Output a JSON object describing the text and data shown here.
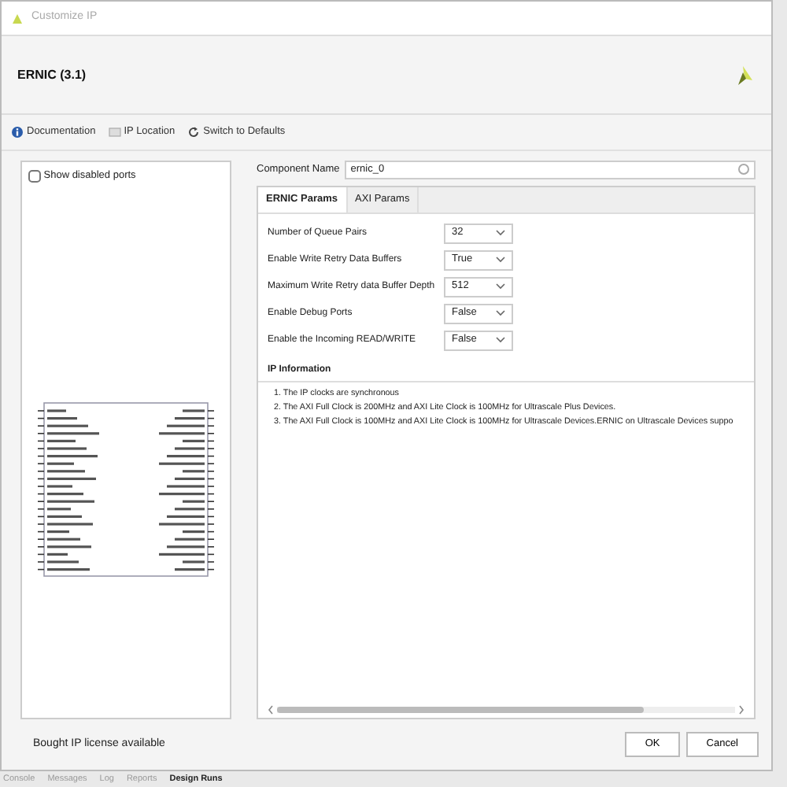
{
  "window": {
    "title": "Customize IP"
  },
  "header": {
    "title": "ERNIC (3.1)"
  },
  "toolbar": [
    {
      "kind": "info",
      "label": "Documentation"
    },
    {
      "kind": "folder",
      "label": "IP Location"
    },
    {
      "kind": "refresh",
      "label": "Switch to Defaults"
    }
  ],
  "left_panel": {
    "show_disabled_ports": {
      "label": "Show disabled ports",
      "checked": false
    }
  },
  "component_name": {
    "label": "Component Name",
    "value": "ernic_0"
  },
  "tabs": [
    {
      "label": "ERNIC Params",
      "selected": true
    },
    {
      "label": "AXI Params",
      "selected": false
    }
  ],
  "params": [
    {
      "label": "Number of Queue Pairs",
      "value": "32"
    },
    {
      "label": "Enable Write Retry Data Buffers",
      "value": "True"
    },
    {
      "label": "Maximum Write Retry data Buffer Depth",
      "value": "512"
    },
    {
      "label": "Enable Debug Ports",
      "value": "False"
    },
    {
      "label": "Enable the Incoming READ/WRITE",
      "value": "False"
    }
  ],
  "ip_information": {
    "title": "IP Information",
    "items": [
      "1. The IP clocks are synchronous",
      "2. The AXI Full Clock is 200MHz and AXI Lite Clock is 100MHz for Ultrascale Plus Devices.",
      "3. The AXI Full Clock is 100MHz and AXI Lite Clock is 100MHz for Ultrascale Devices.ERNIC on Ultrascale Devices suppo"
    ]
  },
  "footer": {
    "note": "Bought IP license available",
    "buttons": [
      "OK",
      "Cancel"
    ]
  },
  "background_tabs": [
    {
      "label": "Console",
      "selected": false
    },
    {
      "label": "Messages",
      "selected": false
    },
    {
      "label": "Log",
      "selected": false
    },
    {
      "label": "Reports",
      "selected": false
    },
    {
      "label": "Design Runs",
      "selected": true
    }
  ]
}
